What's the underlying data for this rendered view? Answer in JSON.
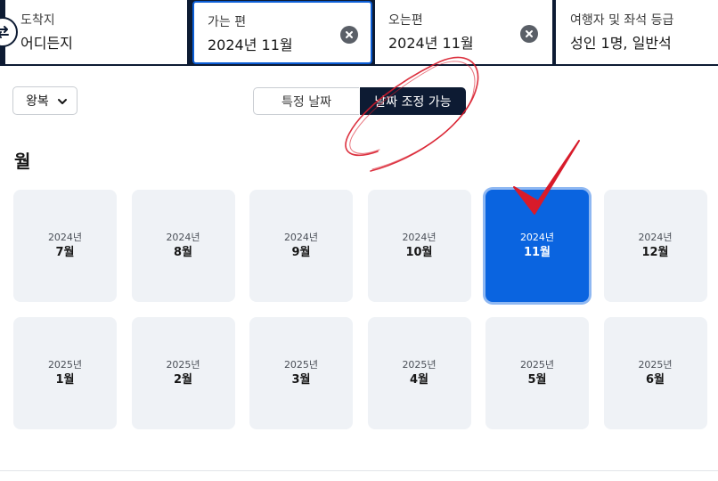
{
  "search": {
    "destination": {
      "label": "도착지",
      "value": "어디든지"
    },
    "depart": {
      "label": "가는 편",
      "value": "2024년 11월"
    },
    "return": {
      "label": "오는편",
      "value": "2024년 11월"
    },
    "travelers": {
      "label": "여행자 및 좌석 등급",
      "value": "성인 1명, 일반석"
    }
  },
  "trip_type": {
    "selected": "왕복"
  },
  "date_tabs": {
    "specific": "특정 날짜",
    "flexible": "날짜 조정 가능"
  },
  "section_title": "월",
  "months": [
    {
      "year": "2024년",
      "month": "7월"
    },
    {
      "year": "2024년",
      "month": "8월"
    },
    {
      "year": "2024년",
      "month": "9월"
    },
    {
      "year": "2024년",
      "month": "10월"
    },
    {
      "year": "2024년",
      "month": "11월",
      "selected": true
    },
    {
      "year": "2024년",
      "month": "12월"
    },
    {
      "year": "2025년",
      "month": "1월"
    },
    {
      "year": "2025년",
      "month": "2월"
    },
    {
      "year": "2025년",
      "month": "3월"
    },
    {
      "year": "2025년",
      "month": "4월"
    },
    {
      "year": "2025년",
      "month": "5월"
    },
    {
      "year": "2025년",
      "month": "6월"
    }
  ],
  "colors": {
    "navy": "#0d1b33",
    "accent": "#0a64e0",
    "card": "#eff2f6",
    "annotation": "#d81b2a"
  },
  "icons": [
    "swap-icon",
    "clear-icon",
    "chevron-down-icon"
  ]
}
